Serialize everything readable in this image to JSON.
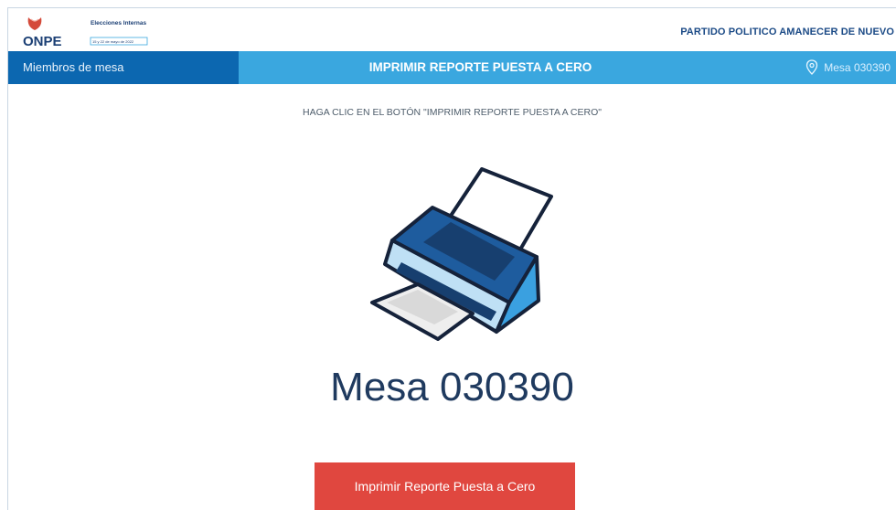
{
  "header": {
    "logo_text": "ONPE",
    "logo_title": "Elecciones Internas",
    "logo_dates": "15 y 22 de mayo de 2022",
    "party_name": "PARTIDO POLITICO AMANECER DE NUEVO"
  },
  "nav": {
    "left_label": "Miembros de mesa",
    "title": "IMPRIMIR REPORTE PUESTA A CERO",
    "mesa_label": "Mesa 030390",
    "icon": "location-pin-icon"
  },
  "main": {
    "instruction": "HAGA CLIC EN EL BOTÓN \"IMPRIMIR REPORTE PUESTA A CERO\"",
    "printer_icon": "printer-icon",
    "mesa_title": "Mesa 030390",
    "button_label": "Imprimir Reporte Puesta a Cero"
  },
  "colors": {
    "nav_dark": "#0c67b0",
    "nav_light": "#3aa7df",
    "party_text": "#1b4a86",
    "button": "#e0473f",
    "title_text": "#1f3a5f"
  }
}
